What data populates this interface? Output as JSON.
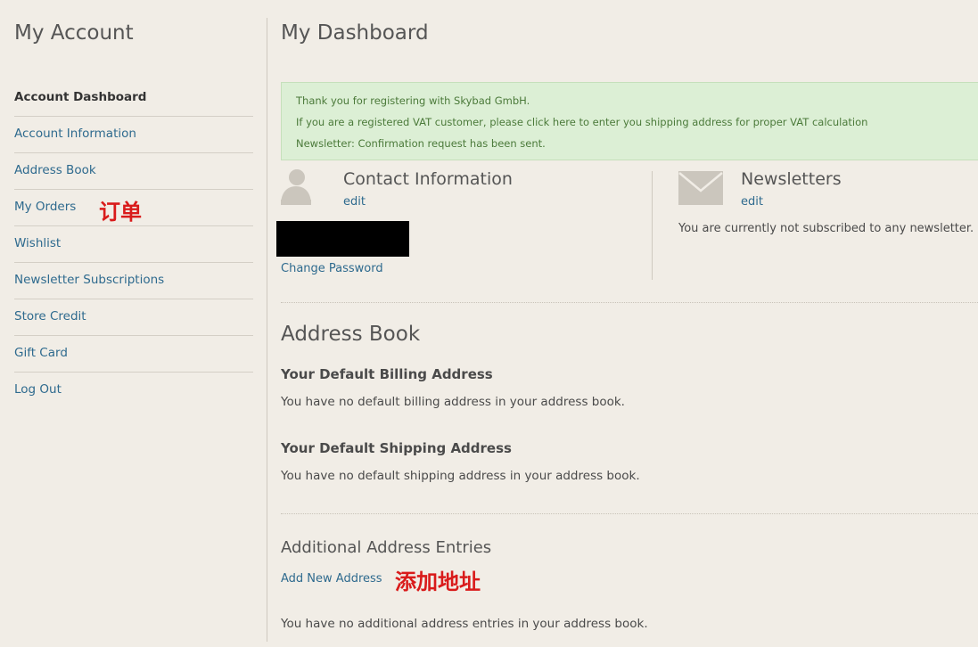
{
  "sidebar": {
    "title": "My Account",
    "items": [
      {
        "label": "Account Dashboard"
      },
      {
        "label": "Account Information"
      },
      {
        "label": "Address Book"
      },
      {
        "label": "My Orders"
      },
      {
        "label": "Wishlist"
      },
      {
        "label": "Newsletter Subscriptions"
      },
      {
        "label": "Store Credit"
      },
      {
        "label": "Gift Card"
      },
      {
        "label": "Log Out"
      }
    ]
  },
  "annotations": {
    "orders": "订单",
    "add_address": "添加地址"
  },
  "main": {
    "title": "My Dashboard",
    "messages": [
      "Thank you for registering with Skybad GmbH.",
      "If you are a registered VAT customer, please click here to enter you shipping address for proper VAT calculation",
      "Newsletter: Confirmation request has been sent."
    ],
    "contact": {
      "title": "Contact Information",
      "edit": "edit",
      "change_password": "Change Password",
      "icon": "user-icon"
    },
    "newsletters": {
      "title": "Newsletters",
      "edit": "edit",
      "status": "You are currently not subscribed to any newsletter.",
      "icon": "mail-icon"
    },
    "address_book": {
      "title": "Address Book",
      "billing_title": "Your Default Billing Address",
      "billing_text": "You have no default billing address in your address book.",
      "shipping_title": "Your Default Shipping Address",
      "shipping_text": "You have no default shipping address in your address book."
    },
    "additional": {
      "title": "Additional Address Entries",
      "add_link": "Add New Address",
      "text": "You have no additional address entries in your address book."
    }
  },
  "colors": {
    "background": "#f1ede6",
    "link": "#2e6a8e",
    "success_bg": "#dcefd5",
    "success_text": "#4b7a3a",
    "annotation": "#d91b1b"
  }
}
